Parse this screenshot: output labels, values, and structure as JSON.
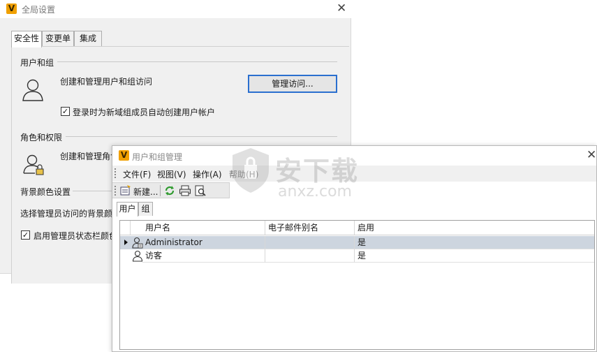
{
  "global_settings": {
    "title": "全局设置",
    "logo_letter": "V",
    "tabs": [
      {
        "label": "安全性",
        "active": true
      },
      {
        "label": "变更单",
        "active": false
      },
      {
        "label": "集成",
        "active": false
      }
    ],
    "users_section": {
      "title": "用户和组",
      "description": "创建和管理用户和组访问",
      "manage_button": "管理访问...",
      "auto_create_checkbox": {
        "label": "登录时为新域组成员自动创建用户帐户",
        "checked": true
      }
    },
    "roles_section": {
      "title": "角色和权限",
      "description": "创建和管理角色"
    },
    "bg_color_section": {
      "title": "背景颜色设置",
      "description": "选择管理员访问的背景颜色",
      "status_bar_checkbox": {
        "label": "启用管理员状态栏颜色",
        "checked": true
      }
    }
  },
  "user_group_manager": {
    "title": "用户和组管理",
    "logo_letter": "V",
    "menu": [
      "文件(F)",
      "视图(V)",
      "操作(A)",
      "帮助(H)"
    ],
    "toolbar": {
      "new_label": "新建...",
      "icons": [
        "new-user-icon",
        "refresh-icon",
        "print-icon",
        "print-preview-icon"
      ]
    },
    "tabs": [
      {
        "label": "用户",
        "active": true
      },
      {
        "label": "组",
        "active": false
      }
    ],
    "table": {
      "columns": [
        "用户名",
        "电子邮件别名",
        "启用"
      ],
      "rows": [
        {
          "username": "Administrator",
          "email": "",
          "enabled": "是",
          "selected": true,
          "icon": "admin-user-icon"
        },
        {
          "username": "访客",
          "email": "",
          "enabled": "是",
          "selected": false,
          "icon": "user-icon"
        }
      ]
    }
  },
  "watermark": {
    "text_cn": "安下载",
    "text_en": "anxz.com"
  },
  "colors": {
    "accent_border": "#2a6fcf",
    "selected_row": "#cdd5df",
    "logo": "#f0a000"
  }
}
